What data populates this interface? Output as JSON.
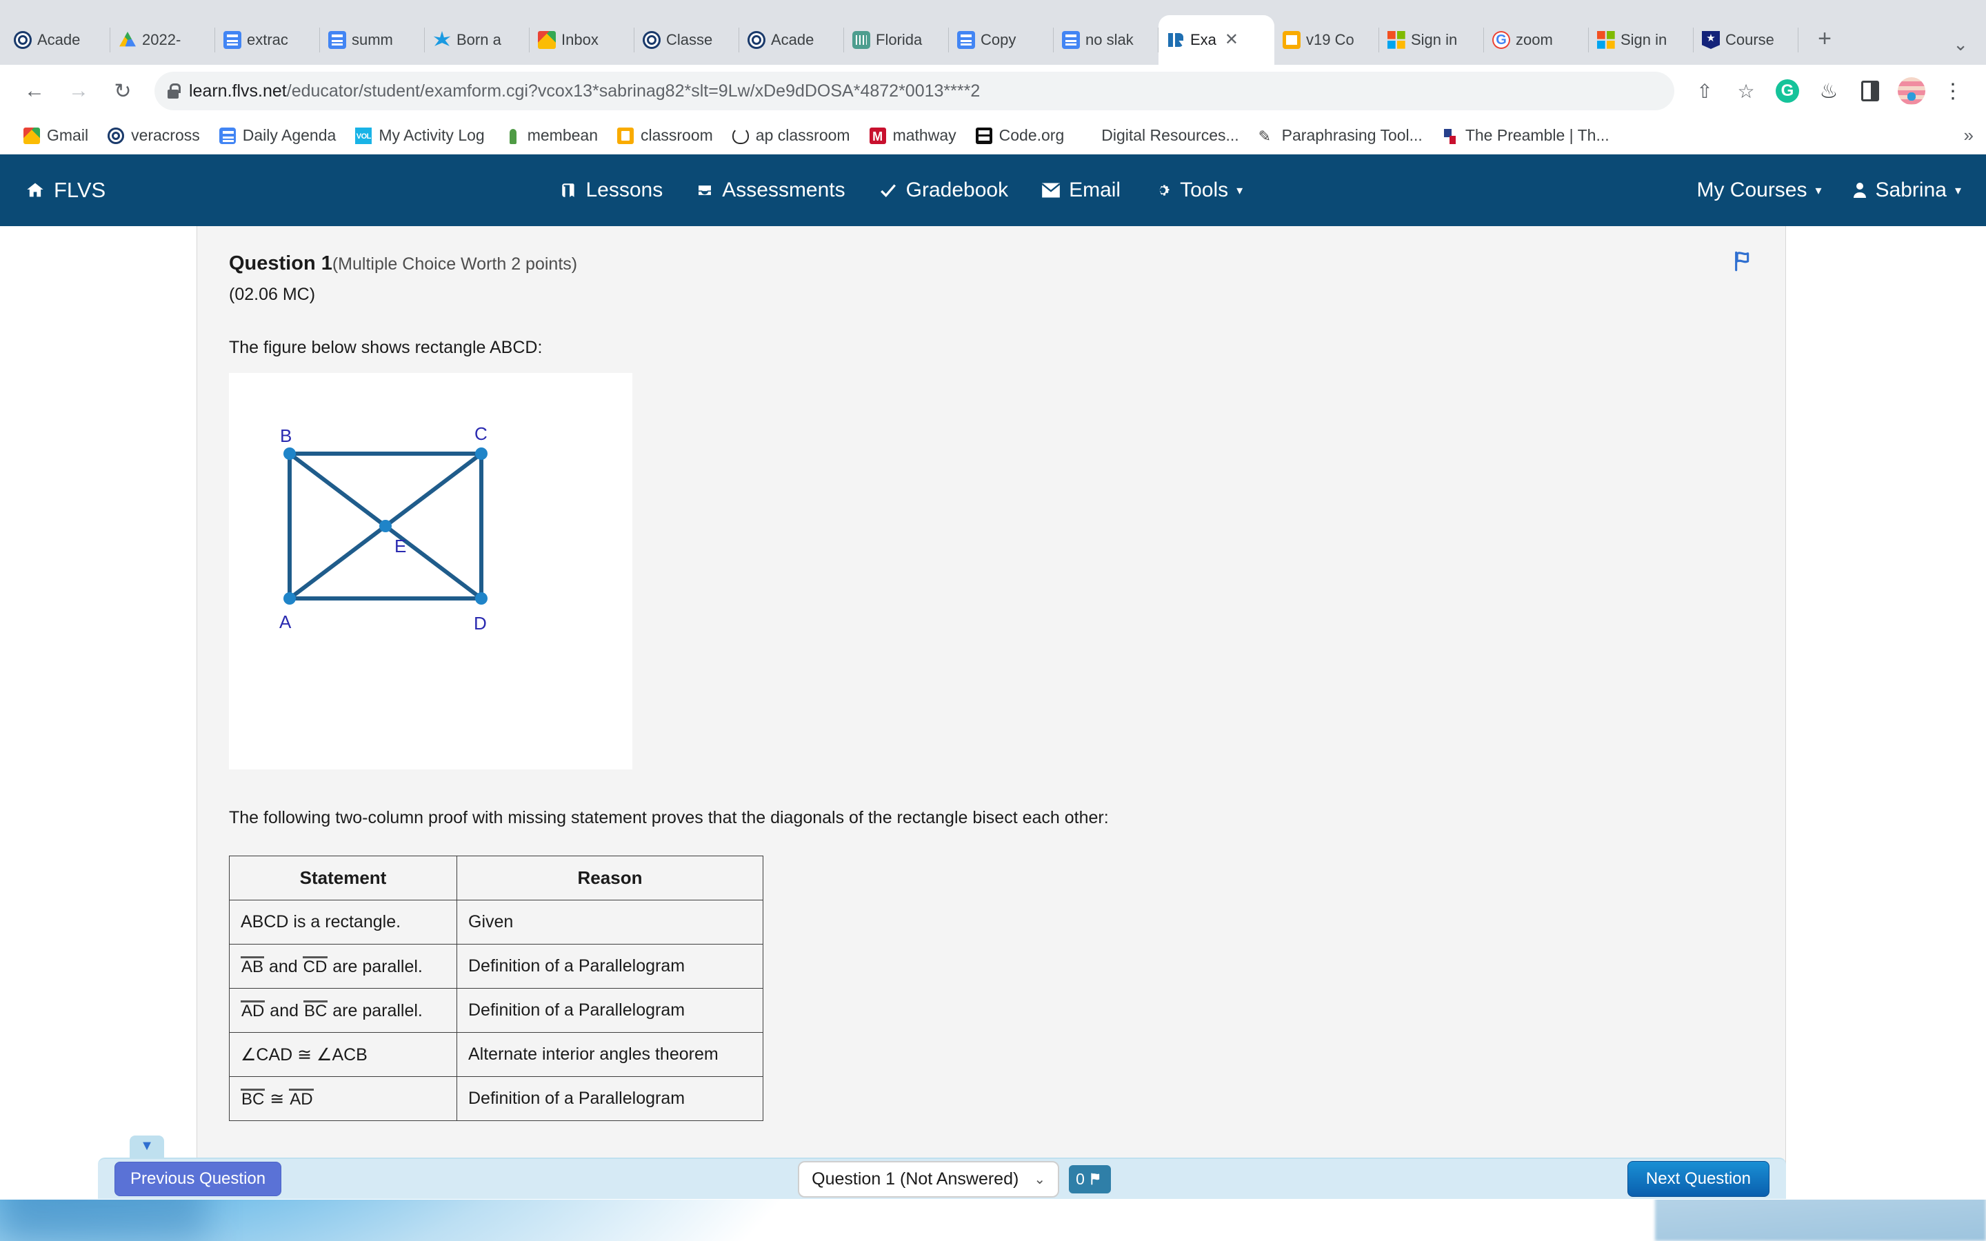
{
  "browser": {
    "tabs": [
      {
        "label": "Acade",
        "icon": "spiral-icon",
        "active": false
      },
      {
        "label": "2022-",
        "icon": "google-drive-icon",
        "active": false
      },
      {
        "label": "extrac",
        "icon": "google-forms-icon",
        "active": false
      },
      {
        "label": "summ",
        "icon": "google-forms-icon",
        "active": false
      },
      {
        "label": "Born a",
        "icon": "asterisk-icon",
        "active": false
      },
      {
        "label": "Inbox",
        "icon": "gmail-icon",
        "active": false
      },
      {
        "label": "Classe",
        "icon": "spiral-icon",
        "active": false
      },
      {
        "label": "Acade",
        "icon": "spiral-icon",
        "active": false
      },
      {
        "label": "Florida",
        "icon": "florida-icon",
        "active": false
      },
      {
        "label": "Copy",
        "icon": "google-forms-icon",
        "active": false
      },
      {
        "label": "no slak",
        "icon": "google-forms-icon",
        "active": false
      },
      {
        "label": "Exa",
        "icon": "exam-icon",
        "active": true,
        "close": "✕"
      },
      {
        "label": "v19 Co",
        "icon": "slide-icon",
        "active": false
      },
      {
        "label": "Sign in",
        "icon": "microsoft-icon",
        "active": false
      },
      {
        "label": "zoom",
        "icon": "google-icon",
        "active": false
      },
      {
        "label": "Sign in",
        "icon": "microsoft-icon",
        "active": false
      },
      {
        "label": "Course",
        "icon": "shield-star-icon",
        "active": false
      }
    ],
    "new_tab_label": "+",
    "tablist_chevron": "⌄",
    "nav": {
      "back": "←",
      "forward": "→",
      "reload": "↻"
    },
    "url_host": "learn.flvs.net",
    "url_path": "/educator/student/examform.cgi?vcox13*sabrinag82*slt=9Lw/xDe9dDOSA*4872*0013****2",
    "toolbar_icons": {
      "share": "⇧",
      "bookmark_star": "☆",
      "grammarly": "G",
      "menu_dots": "⋮"
    },
    "bookmarks": [
      {
        "label": "Gmail",
        "icon": "gmail-icon"
      },
      {
        "label": "veracross",
        "icon": "spiral-icon"
      },
      {
        "label": "Daily Agenda",
        "icon": "google-forms-icon"
      },
      {
        "label": "My Activity Log",
        "icon": "vol-icon"
      },
      {
        "label": "membean",
        "icon": "membean-icon"
      },
      {
        "label": "classroom",
        "icon": "classroom-icon"
      },
      {
        "label": "ap classroom",
        "icon": "ap-icon"
      },
      {
        "label": "mathway",
        "icon": "mathway-icon"
      },
      {
        "label": "Code.org",
        "icon": "code-org-icon"
      },
      {
        "label": "Digital Resources...",
        "icon": "none"
      },
      {
        "label": "Paraphrasing Tool...",
        "icon": "quill-icon"
      },
      {
        "label": "The Preamble | Th...",
        "icon": "preamble-icon"
      }
    ],
    "bookmarks_overflow": "»"
  },
  "flvs_nav": {
    "brand": "FLVS",
    "brand_icon": "home-icon",
    "items": [
      {
        "label": "Lessons",
        "icon": "book-icon"
      },
      {
        "label": "Assessments",
        "icon": "inbox-icon"
      },
      {
        "label": "Gradebook",
        "icon": "check-icon"
      },
      {
        "label": "Email",
        "icon": "envelope-icon"
      },
      {
        "label": "Tools",
        "icon": "gear-icon",
        "caret": "▾"
      }
    ],
    "my_courses": {
      "label": "My Courses",
      "caret": "▾"
    },
    "user": {
      "label": "Sabrina",
      "icon": "person-icon",
      "caret": "▾"
    }
  },
  "question": {
    "number_label": "Question 1",
    "meta_label": "(Multiple Choice Worth 2 points)",
    "code": "(02.06 MC)",
    "intro": "The figure below shows rectangle ABCD:",
    "proof_intro": "The following two-column proof with missing statement proves that the diagonals of the rectangle bisect each other:",
    "flag_icon": "flag-icon"
  },
  "figure": {
    "type": "geometry-diagram",
    "shape": "rectangle with diagonals",
    "vertices": [
      {
        "label": "B",
        "position": "top-left"
      },
      {
        "label": "C",
        "position": "top-right"
      },
      {
        "label": "A",
        "position": "bottom-left"
      },
      {
        "label": "D",
        "position": "bottom-right"
      },
      {
        "label": "E",
        "position": "center-intersection"
      }
    ],
    "line_color": "#1f5c8b",
    "point_color": "#1f84c8",
    "label_color": "#2a2ab0"
  },
  "proof_table": {
    "headers": [
      "Statement",
      "Reason"
    ],
    "rows": [
      {
        "statement_plain": "ABCD is a rectangle.",
        "statement_parts": [
          {
            "t": "text",
            "v": "ABCD is a rectangle."
          }
        ],
        "reason": "Given"
      },
      {
        "statement_plain": "AB and CD are parallel.",
        "statement_parts": [
          {
            "t": "seg",
            "v": "AB"
          },
          {
            "t": "text",
            "v": " and "
          },
          {
            "t": "seg",
            "v": "CD"
          },
          {
            "t": "text",
            "v": " are parallel."
          }
        ],
        "reason": "Definition of a Parallelogram"
      },
      {
        "statement_plain": "AD and BC are parallel.",
        "statement_parts": [
          {
            "t": "seg",
            "v": "AD"
          },
          {
            "t": "text",
            "v": " and "
          },
          {
            "t": "seg",
            "v": "BC"
          },
          {
            "t": "text",
            "v": " are parallel."
          }
        ],
        "reason": "Definition of a Parallelogram"
      },
      {
        "statement_plain": "∠CAD ≅ ∠ACB",
        "statement_parts": [
          {
            "t": "text",
            "v": "∠CAD ≅ ∠ACB"
          }
        ],
        "reason": "Alternate interior angles theorem"
      },
      {
        "statement_plain": "BC ≅ AD",
        "statement_parts": [
          {
            "t": "seg",
            "v": "BC"
          },
          {
            "t": "text",
            "v": " ≅ "
          },
          {
            "t": "seg",
            "v": "AD"
          }
        ],
        "reason": "Definition of a Parallelogram"
      }
    ]
  },
  "exam_bar": {
    "previous_label": "Previous Question",
    "question_selector_value": "Question 1 (Not Answered)",
    "selector_caret": "⌄",
    "flag_count": "0",
    "flag_icon": "flag-icon",
    "next_label": "Next Question",
    "scroll_tab_icon": "▼"
  }
}
